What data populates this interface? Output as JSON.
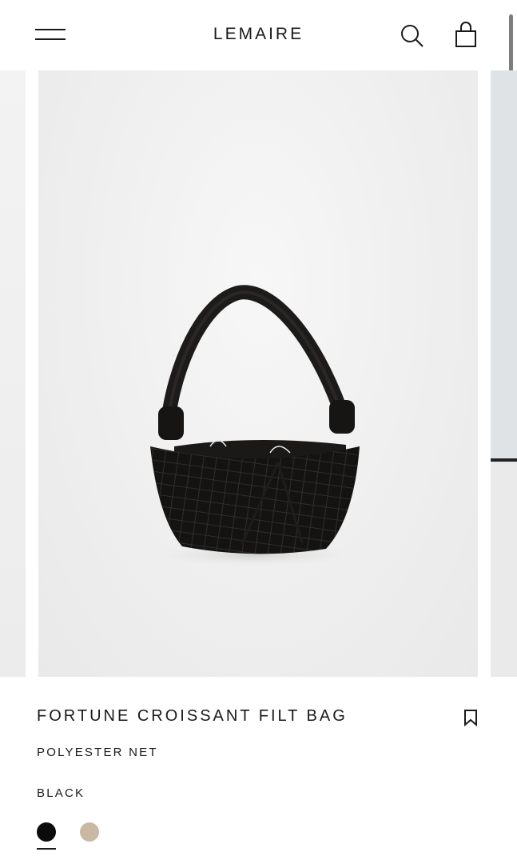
{
  "header": {
    "brand": "LEMAIRE",
    "icons": {
      "menu": "hamburger-menu-icon",
      "search": "search-icon",
      "cart": "shopping-bag-icon"
    }
  },
  "carousel": {
    "main_image_alt": "Black net croissant shoulder bag"
  },
  "product": {
    "title": "FORTUNE CROISSANT FILT BAG",
    "material": "POLYESTER NET",
    "selected_color": "BLACK",
    "bookmark_icon": "bookmark-icon"
  },
  "swatches": [
    {
      "name": "black",
      "color": "#0b0b0b",
      "selected": true
    },
    {
      "name": "beige",
      "color": "#c9b9a3",
      "selected": false
    }
  ]
}
